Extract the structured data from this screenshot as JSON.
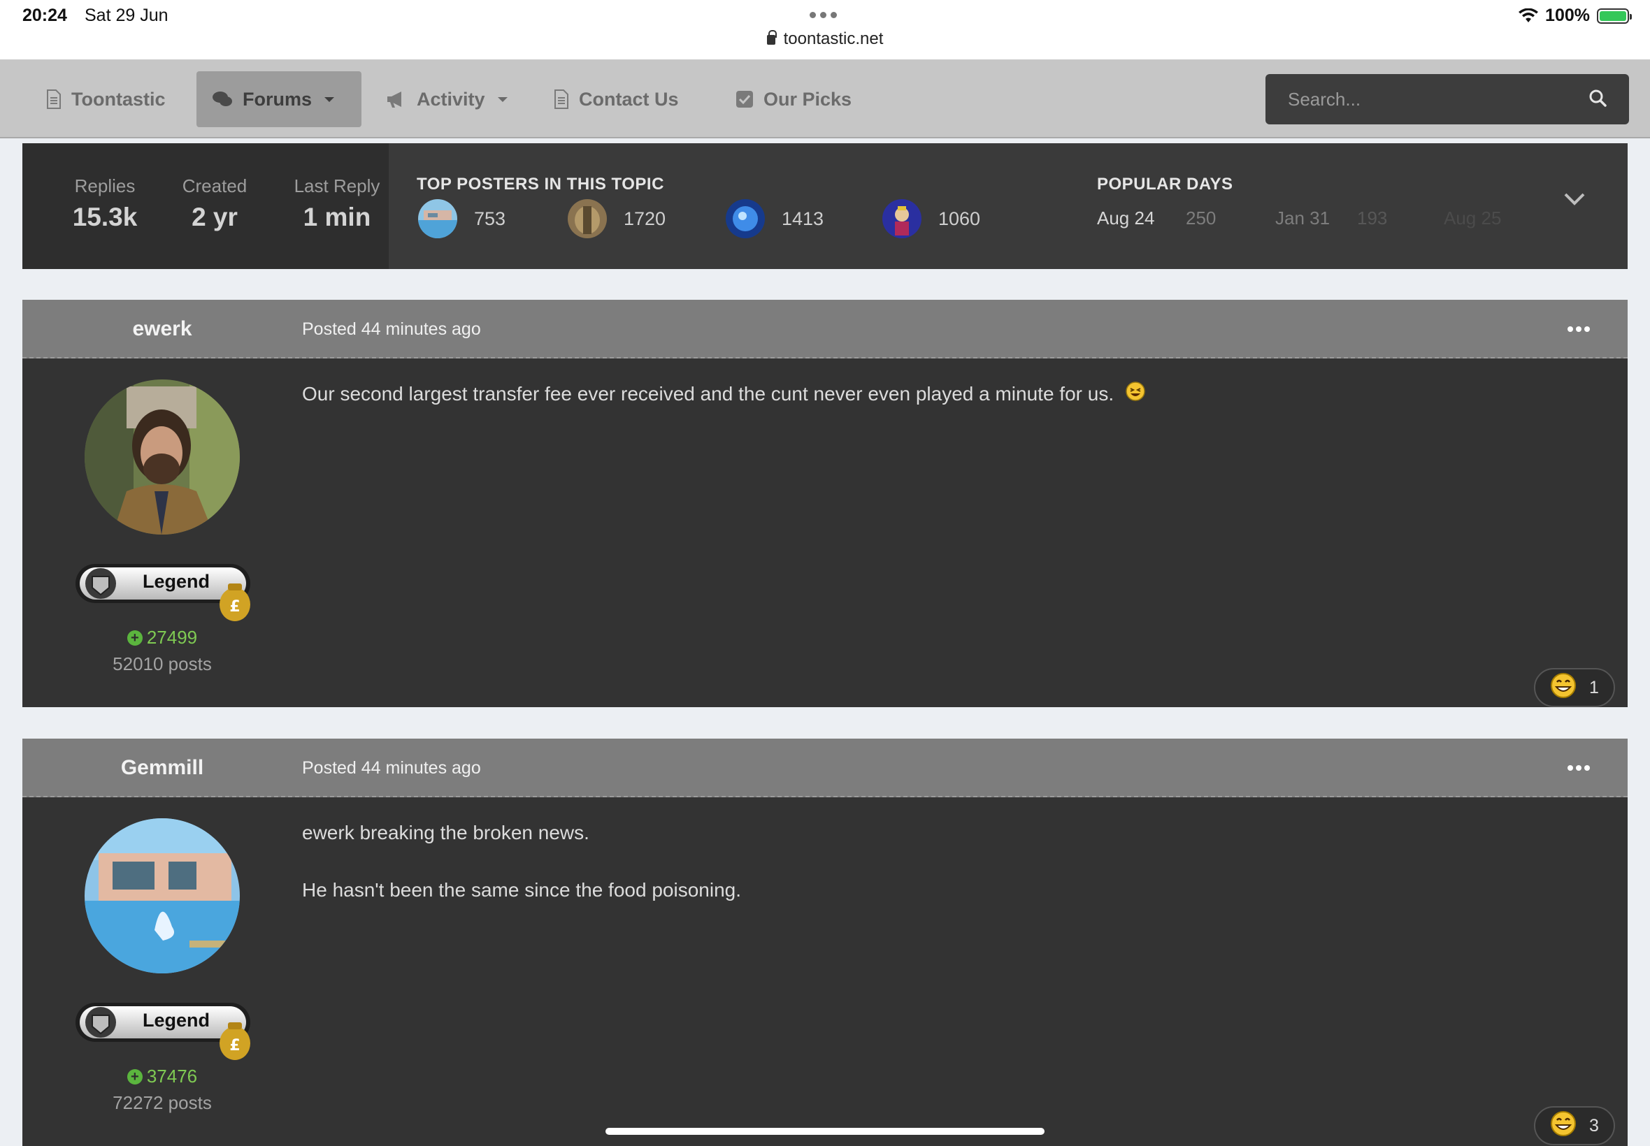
{
  "status": {
    "time": "20:24",
    "date": "Sat 29 Jun",
    "url": "toontastic.net",
    "battery": "100%"
  },
  "nav": {
    "items": [
      {
        "label": "Toontastic",
        "icon": "document-icon"
      },
      {
        "label": "Forums",
        "icon": "chat-bubbles-icon",
        "dropdown": true,
        "active": true
      },
      {
        "label": "Activity",
        "icon": "megaphone-icon",
        "dropdown": true
      },
      {
        "label": "Contact Us",
        "icon": "document-icon"
      },
      {
        "label": "Our Picks",
        "icon": "checkbox-icon"
      }
    ],
    "search_placeholder": "Search..."
  },
  "topic_stats": {
    "replies_label": "Replies",
    "replies": "15.3k",
    "created_label": "Created",
    "created": "2 yr",
    "last_reply_label": "Last Reply",
    "last_reply": "1 min",
    "top_posters_title": "TOP POSTERS IN THIS TOPIC",
    "top_posters": [
      "753",
      "1720",
      "1413",
      "1060"
    ],
    "popular_days_title": "POPULAR DAYS",
    "popular_days": [
      {
        "day": "Aug 24",
        "count": "250"
      },
      {
        "day": "Jan 31",
        "count": "193"
      },
      {
        "day": "Aug 25",
        "count": ""
      }
    ]
  },
  "posts": [
    {
      "author": "ewerk",
      "posted": "Posted 44 minutes ago",
      "rank": "Legend",
      "reputation": "27499",
      "post_count": "52010 posts",
      "content": [
        "Our second largest transfer fee ever received and the cunt never even played a minute for us."
      ],
      "reaction_count": "1"
    },
    {
      "author": "Gemmill",
      "posted": "Posted 44 minutes ago",
      "rank": "Legend",
      "reputation": "37476",
      "post_count": "72272 posts",
      "content": [
        "ewerk breaking the broken news.",
        "He hasn't been the same since the food poisoning."
      ],
      "reaction_count": "3"
    }
  ],
  "colors": {
    "nav_bg": "#c6c6c6",
    "panel_bg": "#3a3a3a",
    "post_head_bg": "#7d7d7d",
    "post_bg": "#333333",
    "reputation_green": "#7fca53"
  }
}
